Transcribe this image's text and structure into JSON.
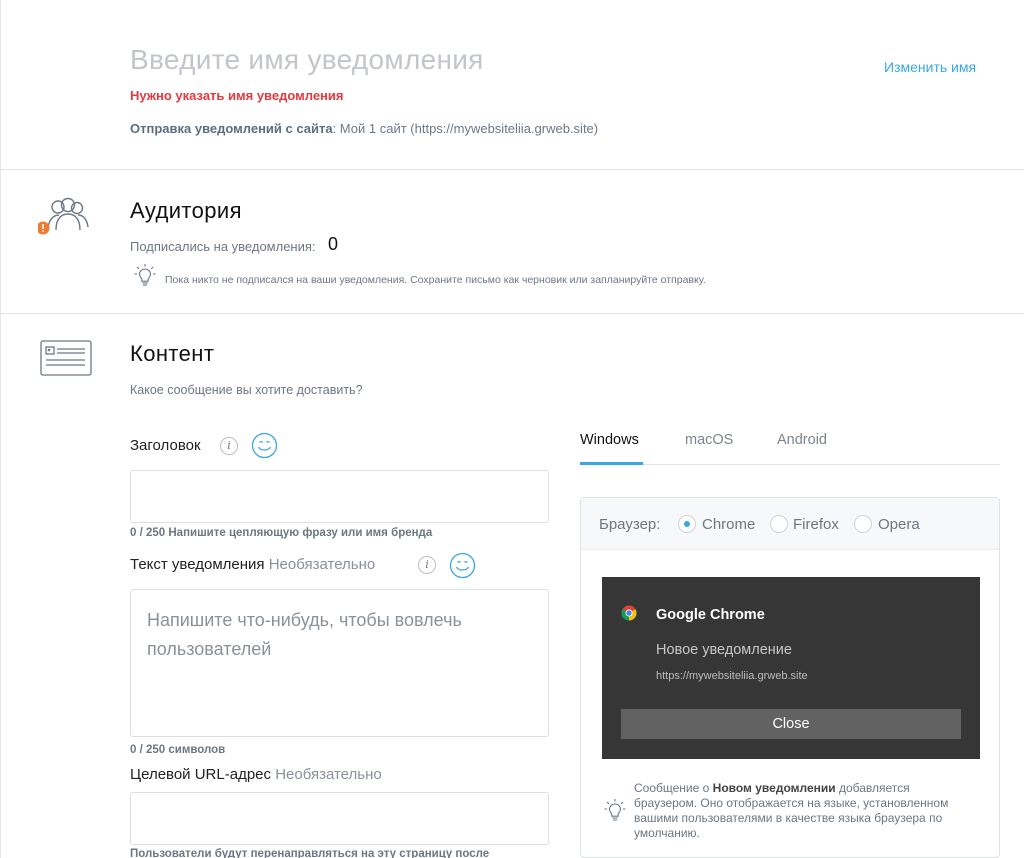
{
  "header": {
    "name_placeholder": "Введите имя уведомления",
    "rename_link": "Изменить имя",
    "error": "Нужно указать имя уведомления",
    "sending_from_label": "Отправка уведомлений с сайта",
    "sending_from_value": ": Мой 1 сайт (https://mywebsiteliia.grweb.site)"
  },
  "audience": {
    "title": "Аудитория",
    "subscribed_label": "Подписались на уведомления:",
    "subscribed_count": "0",
    "hint": "Пока никто не подписался на ваши уведомления. Сохраните письмо как черновик или запланируйте отправку.",
    "warning_color": "#f07c32"
  },
  "content": {
    "title": "Контент",
    "subtitle": "Какое сообщение вы хотите доставить?",
    "headline": {
      "label": "Заголовок",
      "value": "",
      "counter": "0 / 250 Напишите цепляющую фразу или имя бренда"
    },
    "body": {
      "label": "Текст уведомления",
      "optional": "Необязательно",
      "placeholder": "Напишите что-нибудь, чтобы вовлечь пользователей",
      "counter": "0 / 250 символов"
    },
    "url": {
      "label": "Целевой URL-адрес",
      "optional": "Необязательно",
      "value": "",
      "hint": "Пользователи будут перенаправляться на эту страницу после"
    }
  },
  "preview": {
    "tabs": [
      {
        "label": "Windows",
        "active": true
      },
      {
        "label": "macOS",
        "active": false
      },
      {
        "label": "Android",
        "active": false
      }
    ],
    "browser_label": "Браузер:",
    "browsers": [
      {
        "label": "Chrome",
        "selected": true
      },
      {
        "label": "Firefox",
        "selected": false
      },
      {
        "label": "Opera",
        "selected": false
      }
    ],
    "notification": {
      "app": "Google Chrome",
      "title": "Новое уведомление",
      "url": "https://mywebsiteliia.grweb.site",
      "button": "Close"
    },
    "note_prefix": "Сообщение о ",
    "note_bold": "Новом уведомлении",
    "note_suffix": " добавляется браузером. Оно отображается на языке, установленном вашими пользователями в качестве языка браузера по умолчанию."
  },
  "colors": {
    "accent": "#3aa7e2",
    "error": "#e3393f"
  }
}
